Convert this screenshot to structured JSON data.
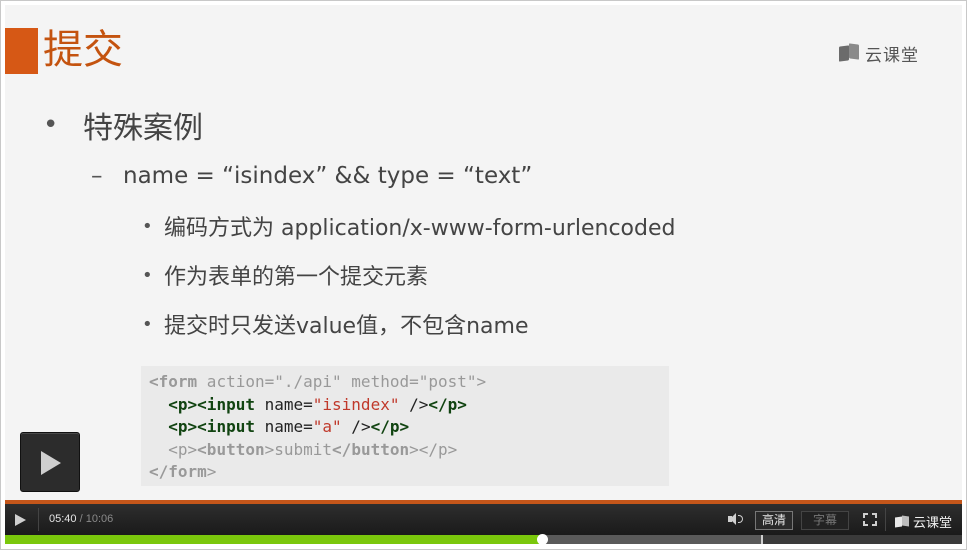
{
  "slide": {
    "title": "提交",
    "brand": "云课堂",
    "bullet1": "特殊案例",
    "bullet2": "name = “isindex” && type = “text”",
    "bullet3": [
      "编码方式为 application/x-www-form-urlencoded",
      "作为表单的第一个提交元素",
      "提交时只发送value值，不包含name"
    ],
    "code": {
      "line1": {
        "open": "<form",
        "attrs": " action=\"./api\" method=\"post\"",
        "close": ">"
      },
      "line2": {
        "p_open": "<p>",
        "input_open": "<input",
        "attr_name": " name=",
        "value": "\"isindex\"",
        "end": " />",
        "p_close": "</p>"
      },
      "line3": {
        "p_open": "<p>",
        "input_open": "<input",
        "attr_name": " name=",
        "value": "\"a\"",
        "end": " />",
        "p_close": "</p>"
      },
      "line4": {
        "p_open": "<p>",
        "btn_open": "<button",
        "btn_gt": ">",
        "text": "submit",
        "btn_close": "</button",
        "btn_close_gt": ">",
        "p_close": "</p>"
      },
      "line5": {
        "close": "</form",
        "gt": ">"
      }
    }
  },
  "player": {
    "current_time": "05:40",
    "total_time": "/ 10:06",
    "hd_label": "高清",
    "subtitle_label": "字幕",
    "brand": "云课堂",
    "progress_fraction": 0.561,
    "buffered_fraction": 0.79,
    "marker_fraction": 0.79,
    "colors": {
      "accent": "#d65815",
      "progress": "#7ac70c"
    }
  },
  "icons": [
    "play-icon",
    "volume-icon",
    "fullscreen-icon",
    "cloud-classroom-logo-icon"
  ]
}
